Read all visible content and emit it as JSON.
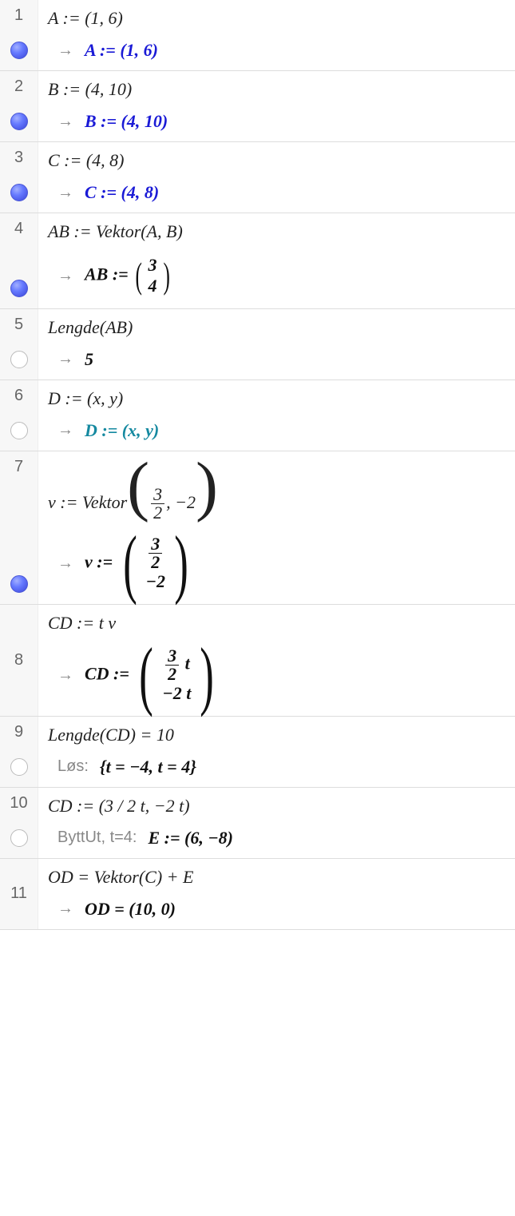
{
  "rows": [
    {
      "num": "1",
      "bullet": "filled",
      "input": "A := (1, 6)",
      "arrow": "→",
      "out_style": "blue",
      "out": "A  :=  (1, 6)"
    },
    {
      "num": "2",
      "bullet": "filled",
      "input": "B := (4, 10)",
      "arrow": "→",
      "out_style": "blue",
      "out": "B  :=  (4, 10)"
    },
    {
      "num": "3",
      "bullet": "filled",
      "input": "C := (4, 8)",
      "arrow": "→",
      "out_style": "blue",
      "out": "C  :=  (4, 8)"
    },
    {
      "num": "4",
      "bullet": "filled",
      "input_type": "text",
      "input": "AB := Vektor(A, B)",
      "arrow": "→",
      "out_style": "black",
      "out_type": "vec",
      "out_label": "AB  :=",
      "vec": [
        "3",
        "4"
      ],
      "paren": "normal"
    },
    {
      "num": "5",
      "bullet": "grey",
      "input": "Lengde(AB)",
      "arrow": "→",
      "out_style": "black",
      "out": "5"
    },
    {
      "num": "6",
      "bullet": "grey",
      "input": "D := (x, y)",
      "arrow": "→",
      "out_style": "teal",
      "out": "D  :=  (x, y)"
    },
    {
      "num": "7",
      "bullet": "filled",
      "input_type": "v_in",
      "input_label": "v := Vektor",
      "input_frac_num": "3",
      "input_frac_den": "2",
      "input_tail": ", −2",
      "arrow": "→",
      "out_style": "black",
      "out_type": "vec_frac",
      "out_label": "v  :=",
      "vec_frac_num": "3",
      "vec_frac_den": "2",
      "vec_second": "−2",
      "paren": "huge"
    },
    {
      "num": "8",
      "bullet": "none",
      "input": "CD := t v",
      "arrow": "→",
      "out_style": "black",
      "out_type": "vec_frac_t",
      "out_label": "CD  :=",
      "vec_frac_num": "3",
      "vec_frac_den": "2",
      "vec_t1": " t",
      "vec_second": "−2 t",
      "paren": "huge"
    },
    {
      "num": "9",
      "bullet": "grey",
      "input": "Lengde(CD)  =  10",
      "out_prefix": "Løs:",
      "out_style": "black",
      "out": "{t = −4, t = 4}"
    },
    {
      "num": "10",
      "bullet": "grey",
      "input": "CD :=  (3  /  2 t,   −2 t)",
      "out_prefix": "ByttUt, t=4:",
      "out_style": "black",
      "out": "E  :=  (6, −8)"
    },
    {
      "num": "11",
      "bullet": "none",
      "input": "OD  =  Vektor(C) + E",
      "arrow": "→",
      "out_style": "black",
      "out": "OD = (10, 0)"
    }
  ]
}
